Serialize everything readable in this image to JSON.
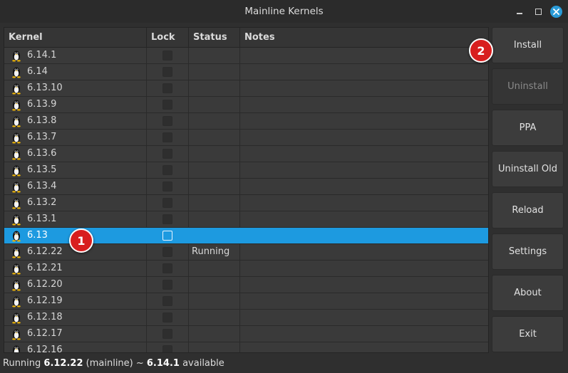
{
  "window": {
    "title": "Mainline Kernels"
  },
  "table": {
    "columns": {
      "kernel": "Kernel",
      "lock": "Lock",
      "status": "Status",
      "notes": "Notes"
    },
    "rows": [
      {
        "version": "6.14.1",
        "status": "",
        "locked": false,
        "selected": false
      },
      {
        "version": "6.14",
        "status": "",
        "locked": false,
        "selected": false
      },
      {
        "version": "6.13.10",
        "status": "",
        "locked": false,
        "selected": false
      },
      {
        "version": "6.13.9",
        "status": "",
        "locked": false,
        "selected": false
      },
      {
        "version": "6.13.8",
        "status": "",
        "locked": false,
        "selected": false
      },
      {
        "version": "6.13.7",
        "status": "",
        "locked": false,
        "selected": false
      },
      {
        "version": "6.13.6",
        "status": "",
        "locked": false,
        "selected": false
      },
      {
        "version": "6.13.5",
        "status": "",
        "locked": false,
        "selected": false
      },
      {
        "version": "6.13.4",
        "status": "",
        "locked": false,
        "selected": false
      },
      {
        "version": "6.13.2",
        "status": "",
        "locked": false,
        "selected": false
      },
      {
        "version": "6.13.1",
        "status": "",
        "locked": false,
        "selected": false
      },
      {
        "version": "6.13",
        "status": "",
        "locked": false,
        "selected": true
      },
      {
        "version": "6.12.22",
        "status": "Running",
        "locked": false,
        "selected": false
      },
      {
        "version": "6.12.21",
        "status": "",
        "locked": false,
        "selected": false
      },
      {
        "version": "6.12.20",
        "status": "",
        "locked": false,
        "selected": false
      },
      {
        "version": "6.12.19",
        "status": "",
        "locked": false,
        "selected": false
      },
      {
        "version": "6.12.18",
        "status": "",
        "locked": false,
        "selected": false
      },
      {
        "version": "6.12.17",
        "status": "",
        "locked": false,
        "selected": false
      },
      {
        "version": "6.12.16",
        "status": "",
        "locked": false,
        "selected": false
      }
    ]
  },
  "buttons": {
    "install": "Install",
    "uninstall": "Uninstall",
    "ppa": "PPA",
    "uninstall_old": "Uninstall Old",
    "reload": "Reload",
    "settings": "Settings",
    "about": "About",
    "exit": "Exit"
  },
  "statusbar": {
    "prefix": "Running ",
    "running_version": "6.12.22",
    "middle": " (mainline) ~ ",
    "available_version": "6.14.1",
    "suffix": " available"
  },
  "annotations": {
    "badge1": "1",
    "badge2": "2"
  },
  "colors": {
    "selection": "#1d9ae0",
    "badge": "#d81e1e",
    "close_button": "#2a9bd8"
  },
  "icons": {
    "kernel_row": "tux-penguin-icon",
    "window_close": "close-icon"
  }
}
